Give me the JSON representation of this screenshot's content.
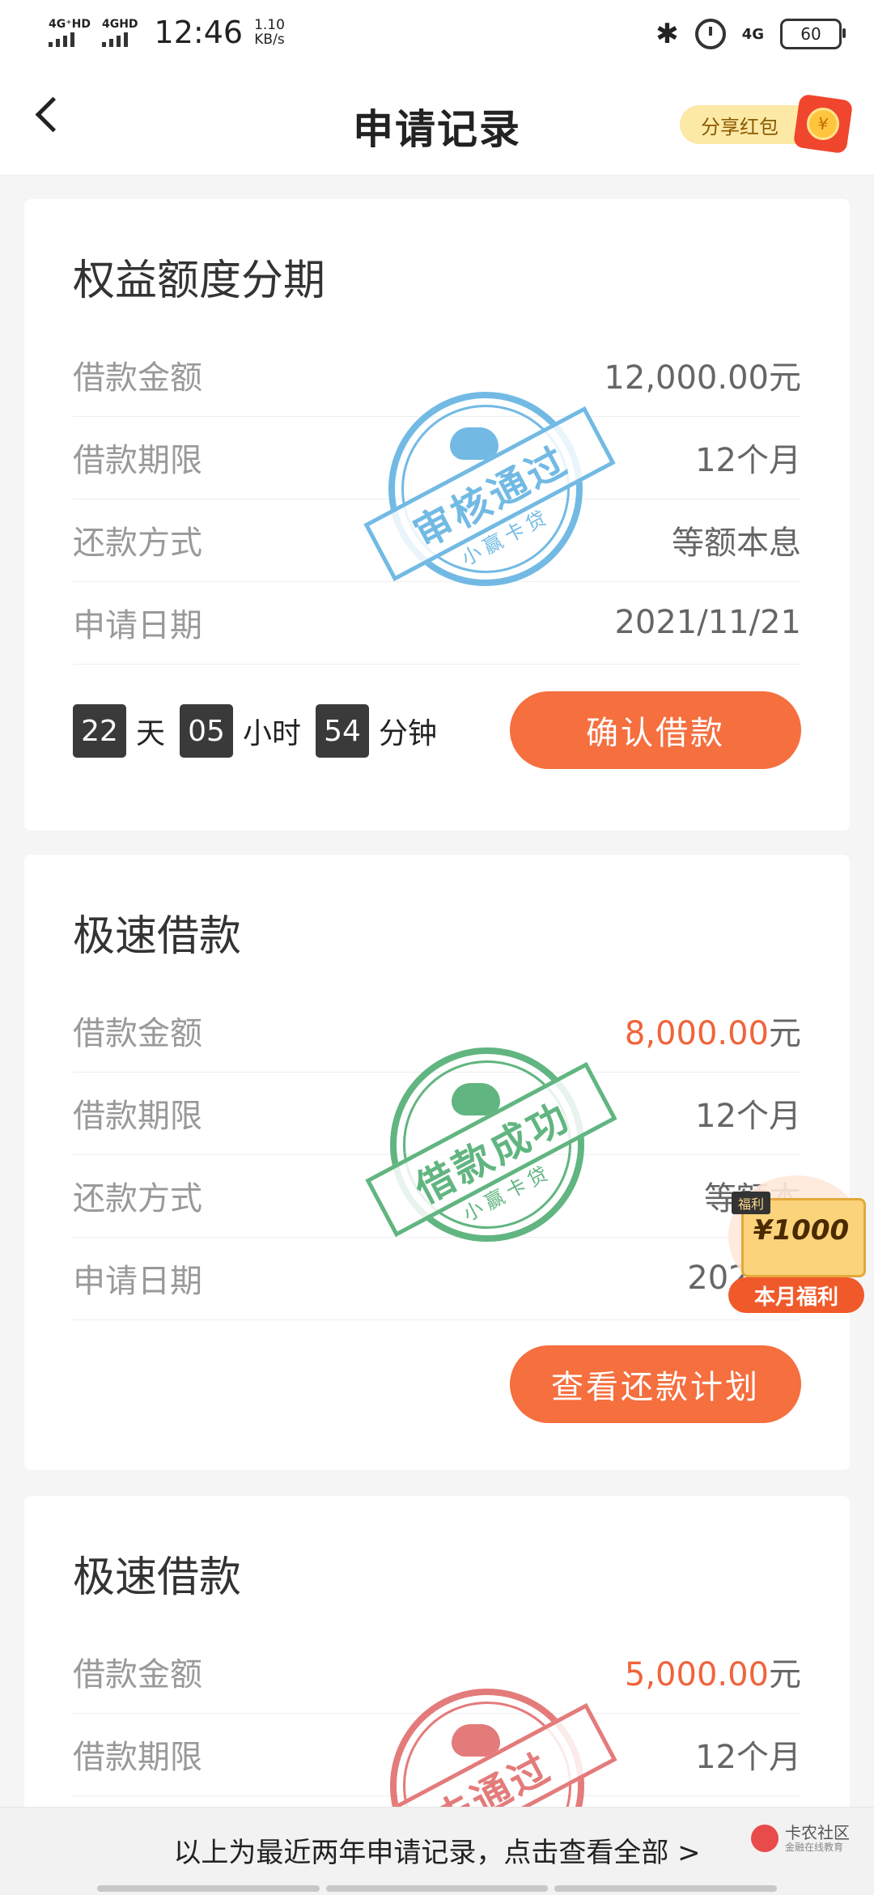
{
  "status_bar": {
    "signal1": "4G⁺HD",
    "signal2": "4GHD",
    "time": "12:46",
    "speed_value": "1.10",
    "speed_unit": "KB/s",
    "net": "4G",
    "battery": "60"
  },
  "header": {
    "title": "申请记录",
    "share_label": "分享红包"
  },
  "cards": [
    {
      "title": "权益额度分期",
      "rows": [
        {
          "label": "借款金额",
          "value": "12,000.00元"
        },
        {
          "label": "借款期限",
          "value": "12个月"
        },
        {
          "label": "还款方式",
          "value": "等额本息"
        },
        {
          "label": "申请日期",
          "value": "2021/11/21"
        }
      ],
      "countdown": {
        "days": "22",
        "days_unit": "天",
        "hours": "05",
        "hours_unit": "小时",
        "minutes": "54",
        "minutes_unit": "分钟"
      },
      "button": "确认借款",
      "stamp": {
        "text": "审核通过",
        "sub": "小赢卡贷",
        "color": "#5aaee0"
      }
    },
    {
      "title": "极速借款",
      "rows": [
        {
          "label": "借款金额",
          "amount": "8,000.00",
          "unit": "元"
        },
        {
          "label": "借款期限",
          "value": "12个月"
        },
        {
          "label": "还款方式",
          "value": "等额本"
        },
        {
          "label": "申请日期",
          "value": "2021/1"
        }
      ],
      "button": "查看还款计划",
      "stamp": {
        "text": "借款成功",
        "sub": "小赢卡贷",
        "color": "#46a96a"
      }
    },
    {
      "title": "极速借款",
      "rows": [
        {
          "label": "借款金额",
          "amount": "5,000.00",
          "unit": "元"
        },
        {
          "label": "借款期限",
          "value": "12个月"
        }
      ],
      "stamp": {
        "text": "未通过",
        "sub": "",
        "color": "#e06565"
      }
    }
  ],
  "welfare": {
    "tag": "福利",
    "amount": "¥1000",
    "label": "本月福利"
  },
  "footer": {
    "text": "以上为最近两年申请记录，点击查看全部 >",
    "watermark_title": "卡农社区",
    "watermark_sub": "金融在线教育"
  }
}
